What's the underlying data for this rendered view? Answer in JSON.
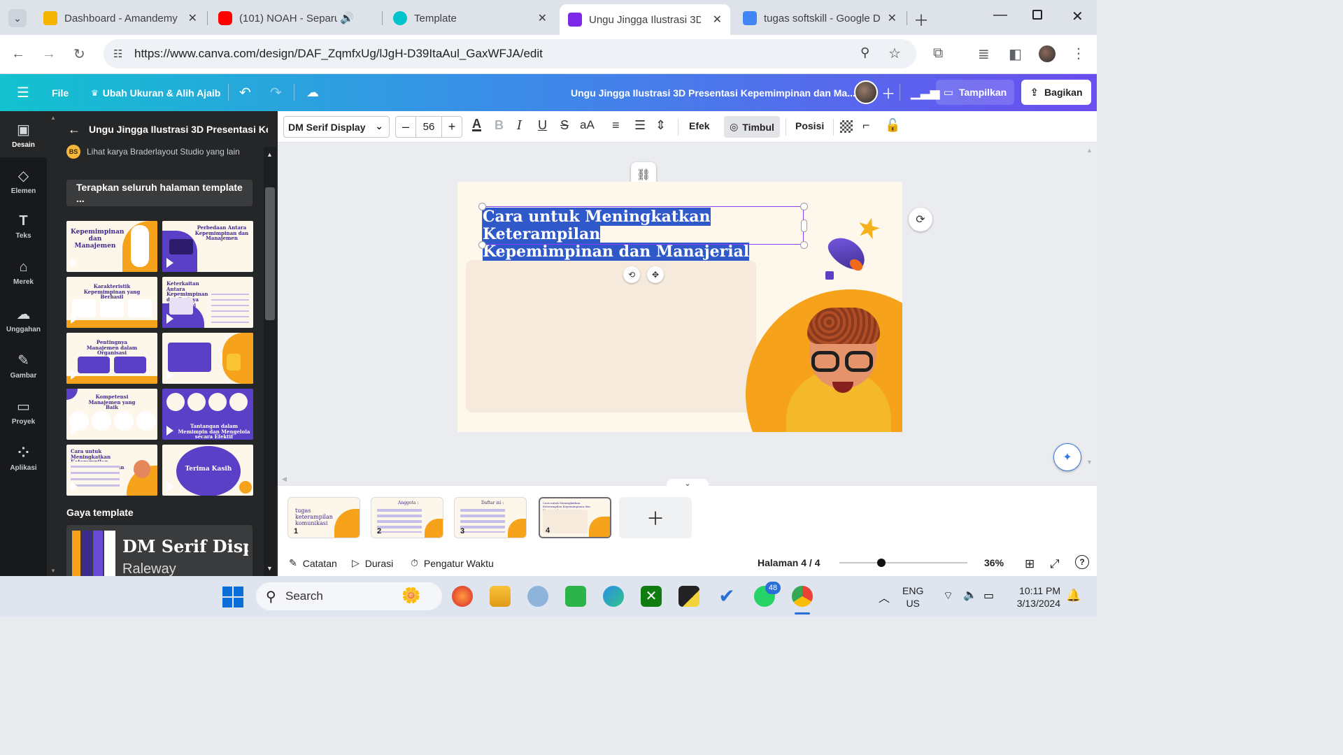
{
  "browser": {
    "tabs": [
      {
        "title": "Dashboard - Amandemy",
        "color": "#f4b400"
      },
      {
        "title": "(101) NOAH - Separu",
        "color": "#ff0000"
      },
      {
        "title": "Template",
        "color": "#00c4cc"
      },
      {
        "title": "Ungu Jingga Ilustrasi 3D",
        "color": "#7d2ae8"
      },
      {
        "title": "tugas softskill - Google D",
        "color": "#4285f4"
      }
    ],
    "url": "https://www.canva.com/design/DAF_ZqmfxUg/lJgH-D39ItaAul_GaxWFJA/edit"
  },
  "canva_header": {
    "file_label": "File",
    "resize_label": "Ubah Ukuran & Alih Ajaib",
    "doc_title": "Ungu Jingga Ilustrasi 3D Presentasi Kepemimpinan dan Ma...",
    "present_label": "Tampilkan",
    "share_label": "Bagikan"
  },
  "rail": [
    {
      "label": "Desain",
      "icon": "▣"
    },
    {
      "label": "Elemen",
      "icon": "◇"
    },
    {
      "label": "Teks",
      "icon": "T"
    },
    {
      "label": "Merek",
      "icon": "⌂"
    },
    {
      "label": "Unggahan",
      "icon": "☁"
    },
    {
      "label": "Gambar",
      "icon": "✎"
    },
    {
      "label": "Proyek",
      "icon": "▭"
    },
    {
      "label": "Aplikasi",
      "icon": "⁘"
    }
  ],
  "panel": {
    "title": "Ungu Jingga Ilustrasi 3D Presentasi Ke...",
    "creator_badge": "BS",
    "creator_text": "Lihat karya Braderlayout Studio yang lain",
    "apply_all": "Terapkan seluruh halaman template ...",
    "thumbnails": [
      "Kepemimpinan dan Manajemen",
      "Perbedaan Antara Kepemimpinan dan Manajemen",
      "Karakteristik Kepemimpinan yang Berhasil",
      "Keterkaitan Antara Kepemimpinan dan Budaya Organisasi",
      "Pentingnya Manajemen dalam Organisasi",
      "",
      "Kompetensi Manajemen yang Baik",
      "Tantangan dalam Memimpin dan Mengelola secara Efektif",
      "Cara untuk Meningkatkan Keterampilan Kepemimpinan dan Manajerial",
      "Terima Kasih"
    ],
    "style_label": "Gaya template",
    "style_font_1": "DM Serif Disp",
    "style_font_2": "Raleway",
    "style_colors": [
      "#f6a21a",
      "#3d2b8c",
      "#6a4ad8",
      "#ffffff"
    ]
  },
  "toolbar": {
    "font": "DM Serif Display",
    "size_minus": "–",
    "size": "56",
    "size_plus": "+",
    "effects": "Efek",
    "animate": "Timbul",
    "position": "Posisi"
  },
  "slide": {
    "title_line1": "Cara untuk Meningkatkan Keterampilan",
    "title_line2": "Kepemimpinan dan Manajerial"
  },
  "pages": [
    {
      "num": "1",
      "text": "tugas keterampilan komunikasi"
    },
    {
      "num": "2",
      "text": "Anggota :"
    },
    {
      "num": "3",
      "text": "Daftar isi :"
    },
    {
      "num": "4",
      "text": "Cara untuk Meningkatkan Keterampilan Kepemimpinan dan Manajerial"
    }
  ],
  "footer": {
    "notes": "Catatan",
    "duration": "Durasi",
    "timer": "Pengatur Waktu",
    "page_indicator": "Halaman 4 / 4",
    "zoom": "36%",
    "zoom_fraction": 0.33
  },
  "taskbar": {
    "search": "Search",
    "lang1": "ENG",
    "lang2": "US",
    "time": "10:11 PM",
    "date": "3/13/2024",
    "whatsapp_badge": "48"
  }
}
